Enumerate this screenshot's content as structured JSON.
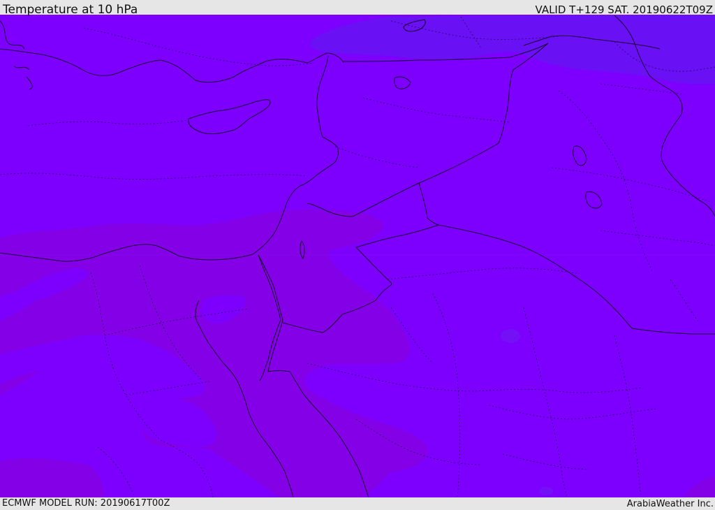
{
  "header": {
    "title": "Temperature at 10 hPa",
    "valid_time": "VALID T+129 SAT. 20190622T09Z"
  },
  "footer": {
    "model_run": "ECMWF MODEL RUN: 20190617T00Z",
    "credit": "ArabiaWeather Inc."
  },
  "map": {
    "variable": "temperature",
    "level": "10 hPa",
    "colors": {
      "base": "#7d00fe",
      "warm_band": "#8400e6",
      "cool_band": "#6a10f4",
      "coastline": "#1a0033",
      "borders": "#2a0060"
    }
  }
}
